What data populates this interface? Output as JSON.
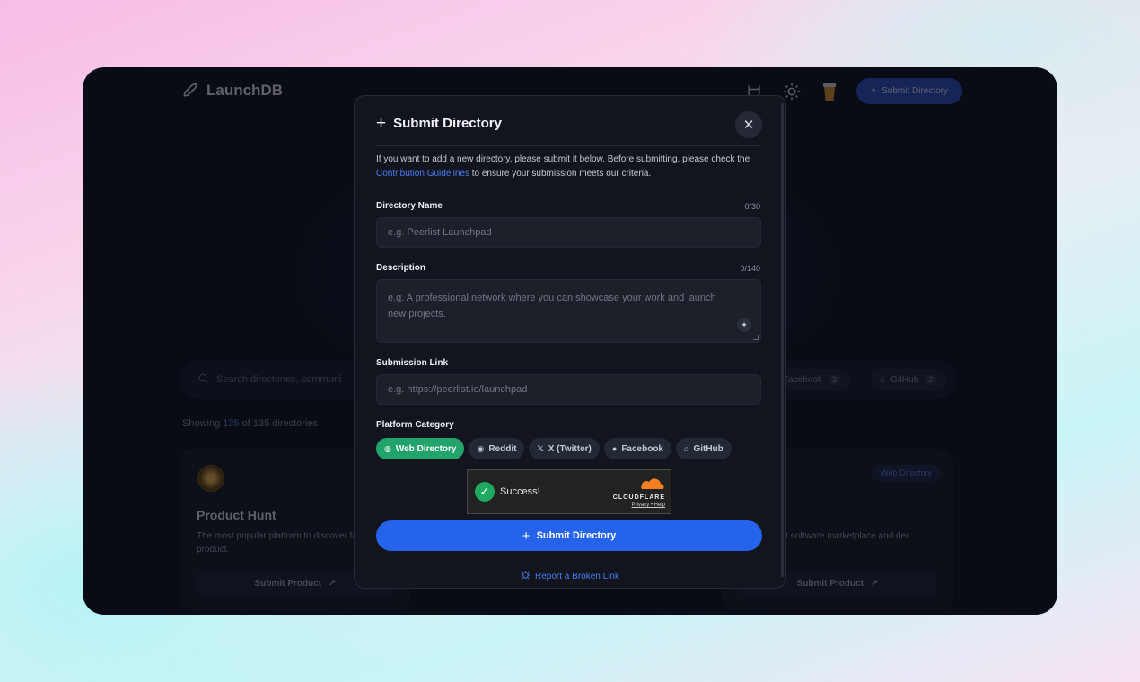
{
  "site": {
    "brand": "LaunchDB",
    "top_submit_label": "Submit Directory",
    "search_placeholder": "Search directories, communi",
    "filters": [
      {
        "label": "Facebook",
        "count": "3"
      },
      {
        "label": "GitHub",
        "count": "2"
      }
    ],
    "showing_prefix": "Showing ",
    "showing_count": "135",
    "showing_suffix": " of 135 directories",
    "cards": [
      {
        "title": "Product Hunt",
        "description": "The most popular platform to discover favorite tech product.",
        "action": "Submit Product"
      },
      {
        "badge": "Web Directory",
        "description": "ent software marketplace and der.",
        "action": "Submit Product"
      }
    ]
  },
  "modal": {
    "title": "Submit Directory",
    "intro_before": "If you want to add a new directory, please submit it below. Before submitting, please check the ",
    "intro_link": "Contribution Guidelines",
    "intro_after": " to ensure your submission meets our criteria.",
    "name_label": "Directory Name",
    "name_counter": "0/30",
    "name_placeholder": "e.g. Peerlist Launchpad",
    "desc_label": "Description",
    "desc_counter": "0/140",
    "desc_placeholder": "e.g. A professional network where you can showcase your work and launch new projects.",
    "link_label": "Submission Link",
    "link_placeholder": "e.g. https://peerlist.io/launchpad",
    "category_label": "Platform Category",
    "categories": [
      {
        "label": "Web Directory",
        "icon": "globe-icon",
        "active": true
      },
      {
        "label": "Reddit",
        "icon": "reddit-icon",
        "active": false
      },
      {
        "label": "X (Twitter)",
        "icon": "x-icon",
        "active": false
      },
      {
        "label": "Facebook",
        "icon": "facebook-icon",
        "active": false
      },
      {
        "label": "GitHub",
        "icon": "github-icon",
        "active": false
      }
    ],
    "captcha": {
      "status": "Success!",
      "provider": "CLOUDFLARE",
      "links": "Privacy • Help"
    },
    "submit_label": "Submit Directory",
    "report_label": "Report a Broken Link"
  },
  "colors": {
    "accent": "#2563eb",
    "active_chip": "#22a36b",
    "link": "#4c7cf4",
    "modal_bg": "#12151d"
  }
}
